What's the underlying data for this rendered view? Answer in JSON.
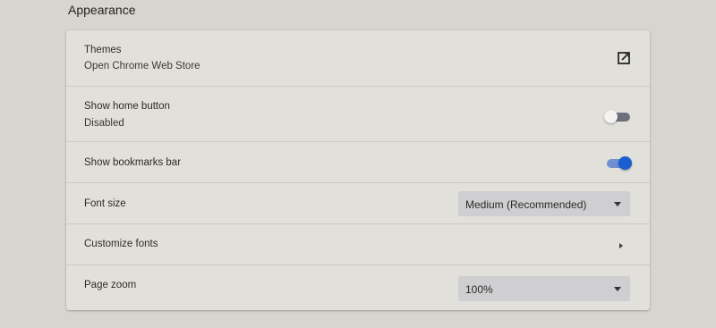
{
  "section": {
    "title": "Appearance"
  },
  "themes": {
    "label": "Themes",
    "sublabel": "Open Chrome Web Store",
    "icon": "open-in-new-icon"
  },
  "home_button": {
    "label": "Show home button",
    "sublabel": "Disabled",
    "enabled": false
  },
  "bookmarks_bar": {
    "label": "Show bookmarks bar",
    "enabled": true
  },
  "font_size": {
    "label": "Font size",
    "selected": "Medium (Recommended)"
  },
  "customize_fonts": {
    "label": "Customize fonts",
    "icon": "chevron-right-icon"
  },
  "page_zoom": {
    "label": "Page zoom",
    "selected": "100%"
  },
  "colors": {
    "accent": "#1a5fd0",
    "toggle_off": "#6e6f7c",
    "card": "#e1e0da",
    "page": "#d6d5cf"
  }
}
